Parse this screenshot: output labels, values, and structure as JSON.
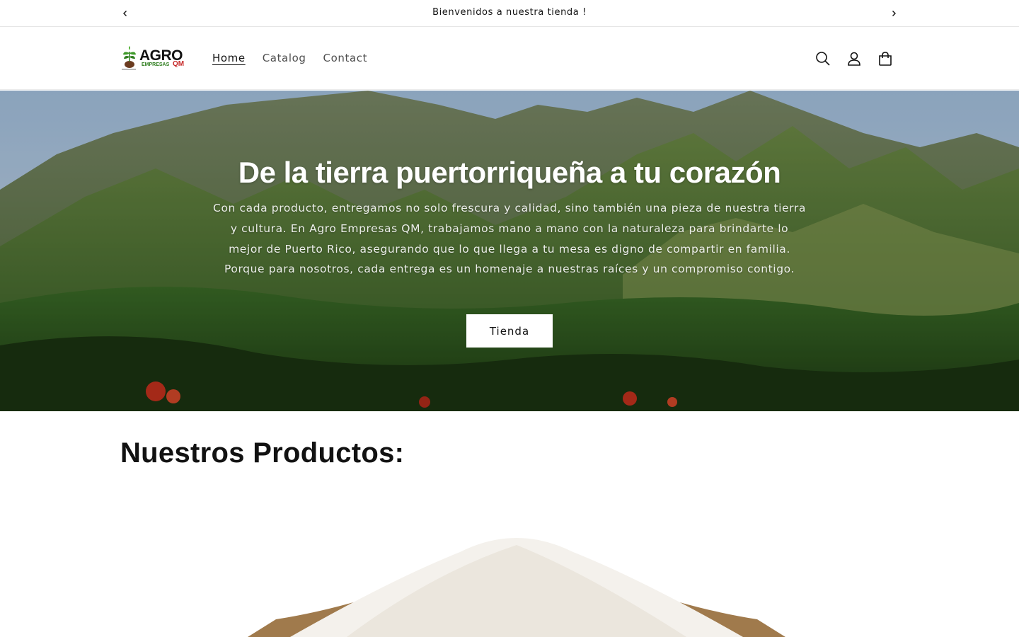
{
  "announcement": {
    "message": "Bienvenidos a nuestra tienda !",
    "prev_icon": "chevron-left-icon",
    "next_icon": "chevron-right-icon"
  },
  "header": {
    "logo": {
      "text_main": "AGRO",
      "text_sub": "EMPRESAS",
      "text_tail": "QM"
    },
    "nav": [
      {
        "label": "Home",
        "active": true
      },
      {
        "label": "Catalog",
        "active": false
      },
      {
        "label": "Contact",
        "active": false
      }
    ],
    "icons": [
      "search-icon",
      "account-icon",
      "cart-icon"
    ]
  },
  "hero": {
    "title": "De la tierra puertorriqueña a tu corazón",
    "text": "Con cada producto, entregamos no solo frescura y calidad, sino también una pieza de nuestra tierra y cultura. En Agro Empresas QM, trabajamos mano a mano con la naturaleza para brindarte lo mejor de Puerto Rico, asegurando que lo que llega a tu mesa es digno de compartir en familia. Porque para nosotros, cada entrega es un homenaje a nuestras raíces y un compromiso contigo.",
    "button_label": "Tienda"
  },
  "products": {
    "title": "Nuestros Productos:"
  },
  "colors": {
    "text": "#121212",
    "logo_green": "#2e7d1e",
    "logo_red": "#c62828"
  }
}
